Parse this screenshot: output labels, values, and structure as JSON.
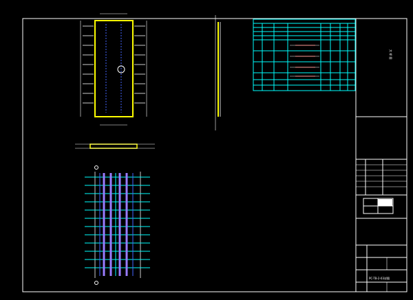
{
  "colors": {
    "background": "#000000",
    "frame": "#ffffff",
    "table": "#00ffff",
    "panel": "#ffff00",
    "rebar": "#4466ff",
    "rebar_highlight": "#9a7cff",
    "accent": "#ff3b30"
  },
  "title_block": {
    "side_label": "",
    "vertical_note": "大 样 图",
    "fields": [
      "",
      "",
      "",
      "",
      "",
      "",
      "",
      ""
    ],
    "drawing_no_label": "",
    "drawing_title": "PC-TB-2-03详图",
    "sheet_label": "",
    "page_no": ""
  },
  "schedule": {
    "title": "",
    "subtitle": "",
    "header": [
      "",
      "",
      "",
      "",
      "",
      "",
      ""
    ],
    "rows": [
      {
        "id": "1",
        "cells": [
          "",
          "",
          "",
          "",
          "",
          ""
        ]
      },
      {
        "id": "2",
        "cells": [
          "",
          "",
          "",
          "",
          "",
          ""
        ]
      },
      {
        "id": "3",
        "cells": [
          "",
          "",
          "",
          "",
          "",
          ""
        ]
      },
      {
        "id": "4",
        "cells": [
          "",
          "",
          "",
          "",
          "",
          ""
        ]
      }
    ],
    "footer": [
      "",
      "",
      "",
      "",
      "",
      ""
    ]
  },
  "views": {
    "plan_label": "",
    "section_label": "",
    "rebar_label": "",
    "note_label": ""
  },
  "icons": {
    "section_marker": "circle-marker",
    "paper_icon": "sheet-icon"
  }
}
